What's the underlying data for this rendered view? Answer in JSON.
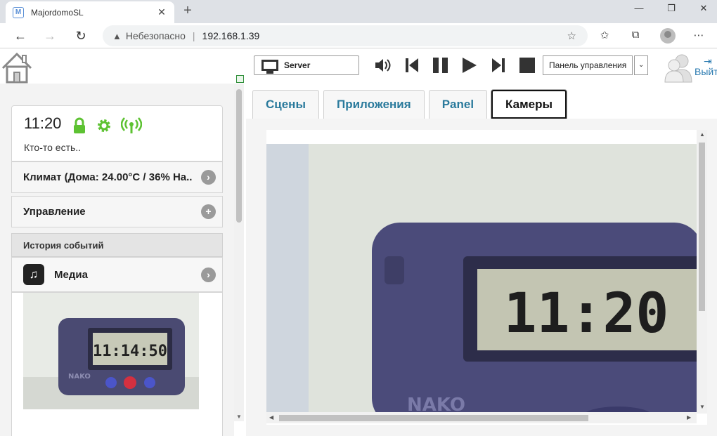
{
  "browser": {
    "tab_title": "MajordomoSL",
    "favicon_letter": "M",
    "tab_close": "✕",
    "new_tab": "+",
    "insecure_label": "Небезопасно",
    "url": "192.168.1.39"
  },
  "status": {
    "time": "11:20",
    "text": "Кто-то есть..",
    "colors": {
      "ok": "#5dc232"
    }
  },
  "left_menu": {
    "climate_label": "Климат (Дома: 24.00°C / 36% На..",
    "control_label": "Управление",
    "history_label": "История событий",
    "media_label": "Медиа"
  },
  "player": {
    "server_label": "Server",
    "panel_select_label": "Панель управления",
    "exit_label": "Выйти"
  },
  "tabs": [
    {
      "label": "Сцены",
      "active": false
    },
    {
      "label": "Приложения",
      "active": false
    },
    {
      "label": "Panel",
      "active": false
    },
    {
      "label": "Камеры",
      "active": true
    }
  ],
  "camera": {
    "display_time": "11:20",
    "brand": "NAKO",
    "thumb_time": "11:14:50",
    "thumb_brand": "NAKO"
  }
}
